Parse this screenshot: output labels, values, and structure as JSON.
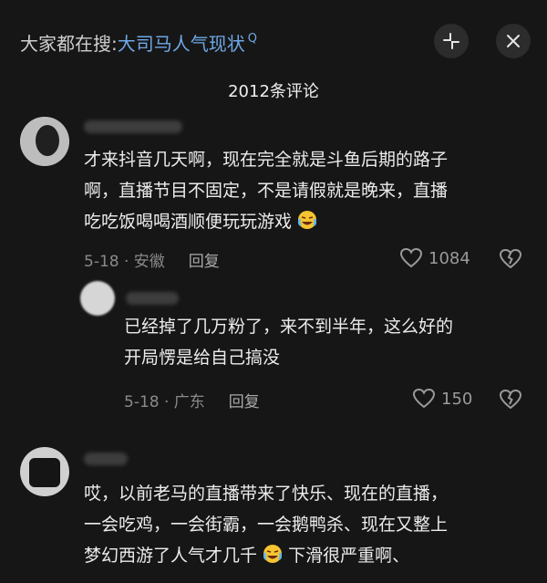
{
  "header": {
    "search_prefix": "大家都在搜:",
    "search_keyword": "大司马人气现状",
    "search_mark": "Q",
    "comment_count": "2012条评论"
  },
  "comments": [
    {
      "lines": [
        "才来抖音几天啊，现在完全就是斗鱼后期的路子",
        "啊，直播节目不固定，不是请假就是晚来，直播",
        "吃吃饭喝喝酒顺便玩玩游戏"
      ],
      "emoji": "laugh-cry",
      "date_location": "5-18 · 安徽",
      "reply_label": "回复",
      "likes": "1084"
    },
    {
      "lines": [
        "已经掉了几万粉了，来不到半年，这么好的",
        "开局愣是给自己搞没"
      ],
      "date_location": "5-18 · 广东",
      "reply_label": "回复",
      "likes": "150"
    },
    {
      "lines": [
        "哎，以前老马的直播带来了快乐、现在的直播，",
        "一会吃鸡，一会街霸，一会鹅鸭杀、现在又整上",
        "梦幻西游了人气才几千"
      ],
      "line3_tail": "下滑很严重啊、",
      "emoji": "laugh-cry"
    }
  ],
  "icons": {
    "collapse": "collapse-arrows-icon",
    "close": "close-icon",
    "like": "heart-outline-icon",
    "dislike": "broken-heart-icon"
  }
}
